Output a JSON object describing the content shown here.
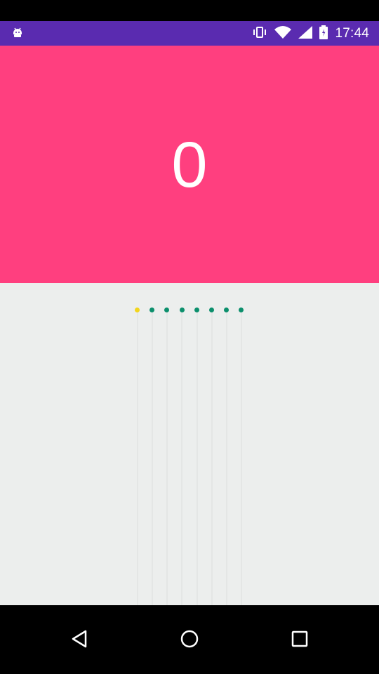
{
  "status_bar": {
    "time": "17:44",
    "color": "#5a2bb0",
    "icons": [
      "android-debug-icon",
      "vibrate-icon",
      "wifi-icon",
      "signal-icon",
      "battery-icon"
    ]
  },
  "counter": {
    "value": "0",
    "background": "#ff3f7f"
  },
  "page_indicator": {
    "count": 8,
    "active_index": 0,
    "active_color": "#f2d51c",
    "inactive_color": "#0b8f6c"
  },
  "nav_bar": {
    "icons": [
      "back-icon",
      "home-icon",
      "recents-icon"
    ]
  }
}
